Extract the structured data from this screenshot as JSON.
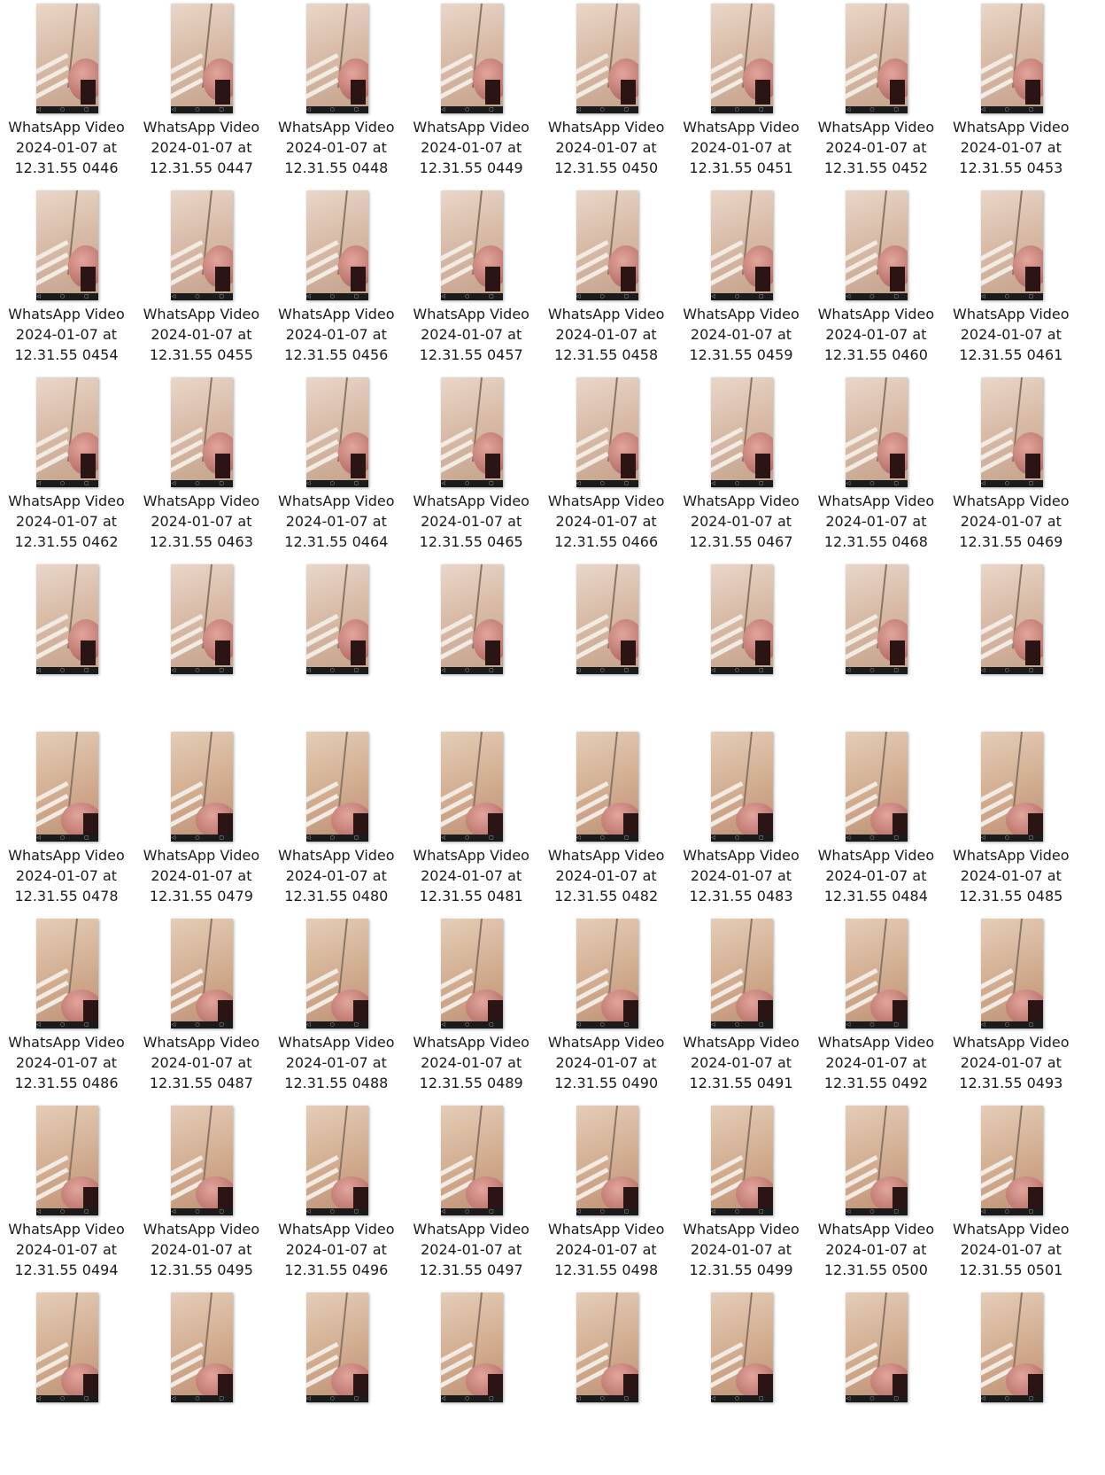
{
  "nav_glyphs": "◁ ○ ▢",
  "files_top": [
    "WhatsApp Video 2024-01-07 at 12.31.55 0446",
    "WhatsApp Video 2024-01-07 at 12.31.55 0447",
    "WhatsApp Video 2024-01-07 at 12.31.55 0448",
    "WhatsApp Video 2024-01-07 at 12.31.55 0449",
    "WhatsApp Video 2024-01-07 at 12.31.55 0450",
    "WhatsApp Video 2024-01-07 at 12.31.55 0451",
    "WhatsApp Video 2024-01-07 at 12.31.55 0452",
    "WhatsApp Video 2024-01-07 at 12.31.55 0453",
    "WhatsApp Video 2024-01-07 at 12.31.55 0454",
    "WhatsApp Video 2024-01-07 at 12.31.55 0455",
    "WhatsApp Video 2024-01-07 at 12.31.55 0456",
    "WhatsApp Video 2024-01-07 at 12.31.55 0457",
    "WhatsApp Video 2024-01-07 at 12.31.55 0458",
    "WhatsApp Video 2024-01-07 at 12.31.55 0459",
    "WhatsApp Video 2024-01-07 at 12.31.55 0460",
    "WhatsApp Video 2024-01-07 at 12.31.55 0461",
    "WhatsApp Video 2024-01-07 at 12.31.55 0462",
    "WhatsApp Video 2024-01-07 at 12.31.55 0463",
    "WhatsApp Video 2024-01-07 at 12.31.55 0464",
    "WhatsApp Video 2024-01-07 at 12.31.55 0465",
    "WhatsApp Video 2024-01-07 at 12.31.55 0466",
    "WhatsApp Video 2024-01-07 at 12.31.55 0467",
    "WhatsApp Video 2024-01-07 at 12.31.55 0468",
    "WhatsApp Video 2024-01-07 at 12.31.55 0469",
    "",
    "",
    "",
    "",
    "",
    "",
    "",
    ""
  ],
  "files_bottom": [
    "WhatsApp Video 2024-01-07 at 12.31.55 0478",
    "WhatsApp Video 2024-01-07 at 12.31.55 0479",
    "WhatsApp Video 2024-01-07 at 12.31.55 0480",
    "WhatsApp Video 2024-01-07 at 12.31.55 0481",
    "WhatsApp Video 2024-01-07 at 12.31.55 0482",
    "WhatsApp Video 2024-01-07 at 12.31.55 0483",
    "WhatsApp Video 2024-01-07 at 12.31.55 0484",
    "WhatsApp Video 2024-01-07 at 12.31.55 0485",
    "WhatsApp Video 2024-01-07 at 12.31.55 0486",
    "WhatsApp Video 2024-01-07 at 12.31.55 0487",
    "WhatsApp Video 2024-01-07 at 12.31.55 0488",
    "WhatsApp Video 2024-01-07 at 12.31.55 0489",
    "WhatsApp Video 2024-01-07 at 12.31.55 0490",
    "WhatsApp Video 2024-01-07 at 12.31.55 0491",
    "WhatsApp Video 2024-01-07 at 12.31.55 0492",
    "WhatsApp Video 2024-01-07 at 12.31.55 0493",
    "WhatsApp Video 2024-01-07 at 12.31.55 0494",
    "WhatsApp Video 2024-01-07 at 12.31.55 0495",
    "WhatsApp Video 2024-01-07 at 12.31.55 0496",
    "WhatsApp Video 2024-01-07 at 12.31.55 0497",
    "WhatsApp Video 2024-01-07 at 12.31.55 0498",
    "WhatsApp Video 2024-01-07 at 12.31.55 0499",
    "WhatsApp Video 2024-01-07 at 12.31.55 0500",
    "WhatsApp Video 2024-01-07 at 12.31.55 0501",
    "",
    "",
    "",
    "",
    "",
    "",
    "",
    ""
  ]
}
